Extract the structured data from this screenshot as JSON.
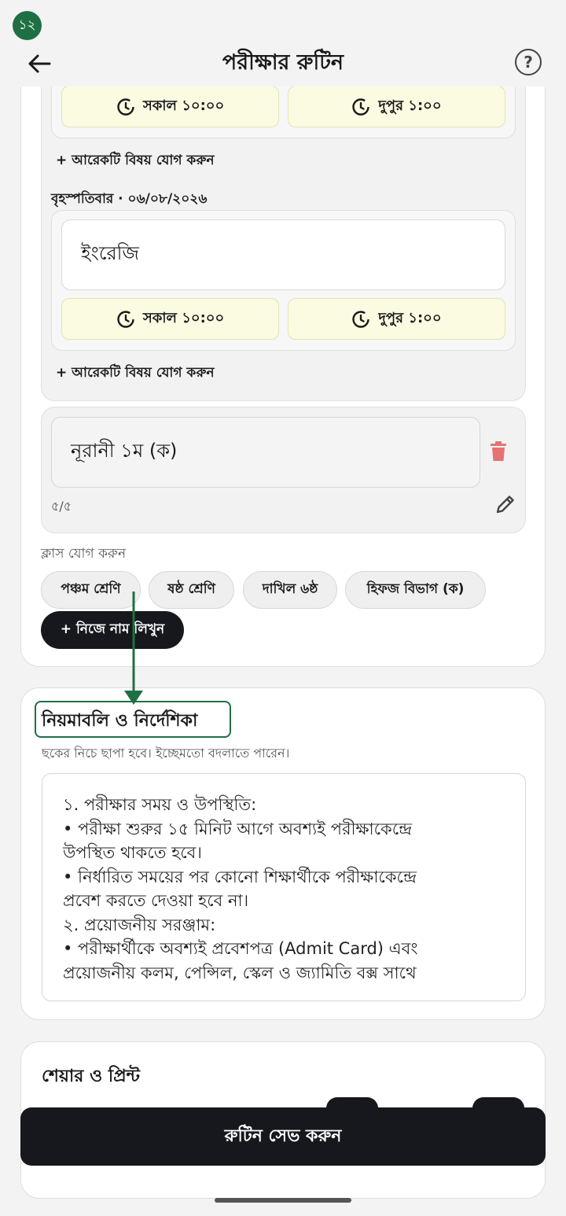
{
  "status_badge": "১২",
  "header": {
    "title": "পরীক্ষার রুটিন",
    "help": "?"
  },
  "day_block_1": {
    "start_time": "সকাল ১০:০০",
    "end_time": "দুপুর ১:০০",
    "add_subject": "+ আরেকটি বিষয় যোগ করুন"
  },
  "day_block_2": {
    "day_label": "বৃহস্পতিবার · ০৬/০৮/২০২৬",
    "subject": "ইংরেজি",
    "start_time": "সকাল ১০:০০",
    "end_time": "দুপুর ১:০০",
    "add_subject": "+ আরেকটি বিষয় যোগ করুন"
  },
  "class_entry": {
    "name": "নূরানী ১ম (ক)",
    "counter": "৫/৫"
  },
  "add_class": {
    "label": "ক্লাস যোগ করুন",
    "chips": [
      "পঞ্চম শ্রেণি",
      "ষষ্ঠ শ্রেণি",
      "দাখিল ৬ষ্ঠ",
      "হিফজ বিভাগ (ক)"
    ],
    "custom": "+ নিজে নাম লিখুন"
  },
  "rules": {
    "title": "নিয়মাবলি ও নির্দেশিকা",
    "hint": "ছকের নিচে ছাপা হবে। ইচ্ছেমতো বদলাতে পারেন।",
    "lines": [
      "১. পরীক্ষার সময় ও উপস্থিতি:",
      "• পরীক্ষা শুরুর ১৫ মিনিট আগে অবশ্যই পরীক্ষাকেন্দ্রে",
      "উপস্থিত থাকতে হবে।",
      "• নির্ধারিত সময়ের পর কোনো শিক্ষার্থীকে পরীক্ষাকেন্দ্রে",
      "প্রবেশ করতে দেওয়া হবে না।",
      "২. প্রয়োজনীয় সরঞ্জাম:",
      "• পরীক্ষার্থীকে অবশ্যই প্রবেশপত্র (Admit Card) এবং",
      "প্রয়োজনীয় কলম, পেন্সিল, স্কেল ও জ্যামিতি বক্স সাথে"
    ]
  },
  "share": {
    "title": "শেয়ার ও প্রিন্ট"
  },
  "save_button": "রুটিন সেভ করুন",
  "colors": {
    "accent": "#1f6f45",
    "time_bg": "#fbfbe2",
    "dark": "#16181d",
    "delete": "#e57373"
  }
}
